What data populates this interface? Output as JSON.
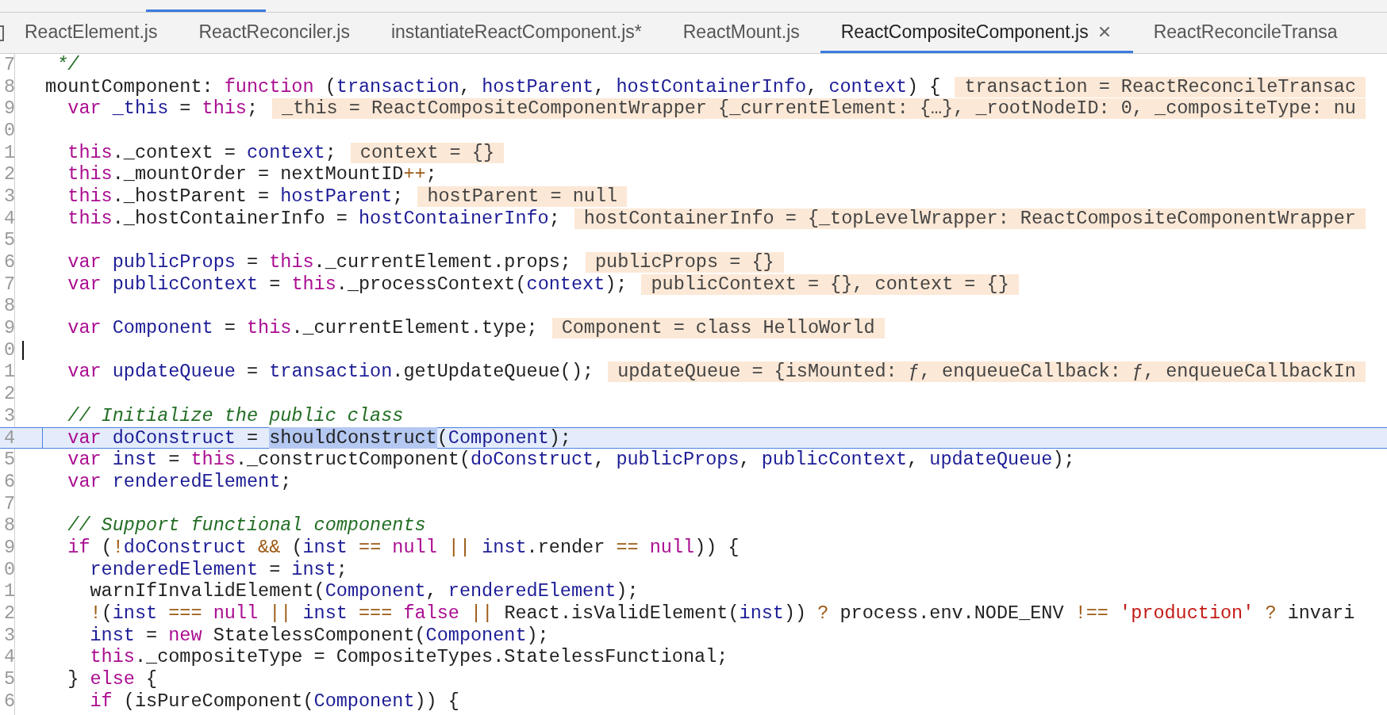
{
  "tabs": [
    {
      "label": "ReactElement.js",
      "selected": false
    },
    {
      "label": "ReactReconciler.js",
      "selected": false
    },
    {
      "label": "instantiateReactComponent.js*",
      "selected": false
    },
    {
      "label": "ReactMount.js",
      "selected": false
    },
    {
      "label": "ReactCompositeComponent.js",
      "selected": true
    },
    {
      "label": "ReactReconcileTransa",
      "selected": false
    }
  ],
  "editor": {
    "lines": [
      {
        "number": "7",
        "current": false,
        "has_cursor": false,
        "tokens": [
          {
            "kind": "comment",
            "text": "  */"
          }
        ]
      },
      {
        "number": "8",
        "current": false,
        "has_cursor": false,
        "tokens": [
          {
            "kind": "plain",
            "text": " mountComponent: "
          },
          {
            "kind": "kw",
            "text": "function"
          },
          {
            "kind": "plain",
            "text": " ("
          },
          {
            "kind": "def",
            "text": "transaction"
          },
          {
            "kind": "plain",
            "text": ", "
          },
          {
            "kind": "def",
            "text": "hostParent"
          },
          {
            "kind": "plain",
            "text": ", "
          },
          {
            "kind": "def",
            "text": "hostContainerInfo"
          },
          {
            "kind": "plain",
            "text": ", "
          },
          {
            "kind": "def",
            "text": "context"
          },
          {
            "kind": "plain",
            "text": ") {"
          }
        ],
        "inline_value": "transaction = ReactReconcileTransac"
      },
      {
        "number": "9",
        "current": false,
        "has_cursor": false,
        "tokens": [
          {
            "kind": "kw",
            "text": "   var "
          },
          {
            "kind": "def",
            "text": "_this"
          },
          {
            "kind": "plain",
            "text": " = "
          },
          {
            "kind": "kw",
            "text": "this"
          },
          {
            "kind": "plain",
            "text": ";"
          }
        ],
        "inline_value": "_this = ReactCompositeComponentWrapper {_currentElement: {…}, _rootNodeID: 0, _compositeType: nu"
      },
      {
        "number": "0",
        "current": false,
        "has_cursor": false
      },
      {
        "number": "1",
        "current": false,
        "has_cursor": false,
        "tokens": [
          {
            "kind": "kw",
            "text": "   this"
          },
          {
            "kind": "plain",
            "text": "._context = "
          },
          {
            "kind": "def",
            "text": "context"
          },
          {
            "kind": "plain",
            "text": ";"
          }
        ],
        "inline_value": "context = {}"
      },
      {
        "number": "2",
        "current": false,
        "has_cursor": false,
        "tokens": [
          {
            "kind": "kw",
            "text": "   this"
          },
          {
            "kind": "plain",
            "text": "._mountOrder = nextMountID"
          },
          {
            "kind": "op",
            "text": "++"
          },
          {
            "kind": "plain",
            "text": ";"
          }
        ]
      },
      {
        "number": "3",
        "current": false,
        "has_cursor": false,
        "tokens": [
          {
            "kind": "kw",
            "text": "   this"
          },
          {
            "kind": "plain",
            "text": "._hostParent = "
          },
          {
            "kind": "def",
            "text": "hostParent"
          },
          {
            "kind": "plain",
            "text": ";"
          }
        ],
        "inline_value": "hostParent = null"
      },
      {
        "number": "4",
        "current": false,
        "has_cursor": false,
        "tokens": [
          {
            "kind": "kw",
            "text": "   this"
          },
          {
            "kind": "plain",
            "text": "._hostContainerInfo = "
          },
          {
            "kind": "def",
            "text": "hostContainerInfo"
          },
          {
            "kind": "plain",
            "text": ";"
          }
        ],
        "inline_value": "hostContainerInfo = {_topLevelWrapper: ReactCompositeComponentWrapper"
      },
      {
        "number": "5",
        "current": false,
        "has_cursor": false
      },
      {
        "number": "6",
        "current": false,
        "has_cursor": false,
        "tokens": [
          {
            "kind": "kw",
            "text": "   var "
          },
          {
            "kind": "def",
            "text": "publicProps"
          },
          {
            "kind": "plain",
            "text": " = "
          },
          {
            "kind": "kw",
            "text": "this"
          },
          {
            "kind": "plain",
            "text": "._currentElement.props;"
          }
        ],
        "inline_value": "publicProps = {}"
      },
      {
        "number": "7",
        "current": false,
        "has_cursor": false,
        "tokens": [
          {
            "kind": "kw",
            "text": "   var "
          },
          {
            "kind": "def",
            "text": "publicContext"
          },
          {
            "kind": "plain",
            "text": " = "
          },
          {
            "kind": "kw",
            "text": "this"
          },
          {
            "kind": "plain",
            "text": "._processContext("
          },
          {
            "kind": "def",
            "text": "context"
          },
          {
            "kind": "plain",
            "text": ");"
          }
        ],
        "inline_value": "publicContext = {}, context = {}"
      },
      {
        "number": "8",
        "current": false,
        "has_cursor": false
      },
      {
        "number": "9",
        "current": false,
        "has_cursor": false,
        "tokens": [
          {
            "kind": "kw",
            "text": "   var "
          },
          {
            "kind": "def",
            "text": "Component"
          },
          {
            "kind": "plain",
            "text": " = "
          },
          {
            "kind": "kw",
            "text": "this"
          },
          {
            "kind": "plain",
            "text": "._currentElement.type;"
          }
        ],
        "inline_value": "Component = class HelloWorld"
      },
      {
        "number": "0",
        "current": false,
        "has_cursor": true
      },
      {
        "number": "1",
        "current": false,
        "has_cursor": false,
        "tokens": [
          {
            "kind": "kw",
            "text": "   var "
          },
          {
            "kind": "def",
            "text": "updateQueue"
          },
          {
            "kind": "plain",
            "text": " = "
          },
          {
            "kind": "def",
            "text": "transaction"
          },
          {
            "kind": "plain",
            "text": ".getUpdateQueue();"
          }
        ],
        "inline_value": "updateQueue = {isMounted: ƒ, enqueueCallback: ƒ, enqueueCallbackIn"
      },
      {
        "number": "2",
        "current": false,
        "has_cursor": false
      },
      {
        "number": "3",
        "current": false,
        "has_cursor": false,
        "tokens": [
          {
            "kind": "comment",
            "text": "   // Initialize the public class"
          }
        ]
      },
      {
        "number": "4",
        "current": true,
        "has_cursor": false,
        "tokens": [
          {
            "kind": "kw",
            "text": "   var ",
            "selected": false
          },
          {
            "kind": "def",
            "text": "doConstruct",
            "selected": false
          },
          {
            "kind": "plain",
            "text": " = ",
            "selected": false
          },
          {
            "kind": "plain",
            "text": "shouldConstruct",
            "selected": true
          },
          {
            "kind": "plain",
            "text": "(",
            "selected": false
          },
          {
            "kind": "def",
            "text": "Component",
            "selected": false
          },
          {
            "kind": "plain",
            "text": ");",
            "selected": false
          }
        ]
      },
      {
        "number": "5",
        "current": false,
        "has_cursor": false,
        "tokens": [
          {
            "kind": "kw",
            "text": "   var "
          },
          {
            "kind": "def",
            "text": "inst"
          },
          {
            "kind": "plain",
            "text": " = "
          },
          {
            "kind": "kw",
            "text": "this"
          },
          {
            "kind": "plain",
            "text": "._constructComponent("
          },
          {
            "kind": "def",
            "text": "doConstruct"
          },
          {
            "kind": "plain",
            "text": ", "
          },
          {
            "kind": "def",
            "text": "publicProps"
          },
          {
            "kind": "plain",
            "text": ", "
          },
          {
            "kind": "def",
            "text": "publicContext"
          },
          {
            "kind": "plain",
            "text": ", "
          },
          {
            "kind": "def",
            "text": "updateQueue"
          },
          {
            "kind": "plain",
            "text": ");"
          }
        ]
      },
      {
        "number": "6",
        "current": false,
        "has_cursor": false,
        "tokens": [
          {
            "kind": "kw",
            "text": "   var "
          },
          {
            "kind": "def",
            "text": "renderedElement"
          },
          {
            "kind": "plain",
            "text": ";"
          }
        ]
      },
      {
        "number": "7",
        "current": false,
        "has_cursor": false
      },
      {
        "number": "8",
        "current": false,
        "has_cursor": false,
        "tokens": [
          {
            "kind": "comment",
            "text": "   // Support functional components"
          }
        ]
      },
      {
        "number": "9",
        "current": false,
        "has_cursor": false,
        "tokens": [
          {
            "kind": "kw",
            "text": "   if"
          },
          {
            "kind": "plain",
            "text": " ("
          },
          {
            "kind": "op",
            "text": "!"
          },
          {
            "kind": "def",
            "text": "doConstruct "
          },
          {
            "kind": "op",
            "text": "&&"
          },
          {
            "kind": "plain",
            "text": " ("
          },
          {
            "kind": "def",
            "text": "inst "
          },
          {
            "kind": "op",
            "text": "== "
          },
          {
            "kind": "kw",
            "text": "null "
          },
          {
            "kind": "op",
            "text": "|| "
          },
          {
            "kind": "def",
            "text": "inst"
          },
          {
            "kind": "plain",
            "text": ".render "
          },
          {
            "kind": "op",
            "text": "== "
          },
          {
            "kind": "kw",
            "text": "null"
          },
          {
            "kind": "plain",
            "text": ")) {"
          }
        ]
      },
      {
        "number": "0",
        "current": false,
        "has_cursor": false,
        "tokens": [
          {
            "kind": "def",
            "text": "     renderedElement"
          },
          {
            "kind": "plain",
            "text": " = "
          },
          {
            "kind": "def",
            "text": "inst"
          },
          {
            "kind": "plain",
            "text": ";"
          }
        ]
      },
      {
        "number": "1",
        "current": false,
        "has_cursor": false,
        "tokens": [
          {
            "kind": "plain",
            "text": "     warnIfInvalidElement("
          },
          {
            "kind": "def",
            "text": "Component"
          },
          {
            "kind": "plain",
            "text": ", "
          },
          {
            "kind": "def",
            "text": "renderedElement"
          },
          {
            "kind": "plain",
            "text": ");"
          }
        ]
      },
      {
        "number": "2",
        "current": false,
        "has_cursor": false,
        "tokens": [
          {
            "kind": "op",
            "text": "     !"
          },
          {
            "kind": "plain",
            "text": "("
          },
          {
            "kind": "def",
            "text": "inst "
          },
          {
            "kind": "op",
            "text": "=== "
          },
          {
            "kind": "kw",
            "text": "null "
          },
          {
            "kind": "op",
            "text": "|| "
          },
          {
            "kind": "def",
            "text": "inst "
          },
          {
            "kind": "op",
            "text": "=== "
          },
          {
            "kind": "kw",
            "text": "false "
          },
          {
            "kind": "op",
            "text": "||"
          },
          {
            "kind": "plain",
            "text": " React.isValidElement("
          },
          {
            "kind": "def",
            "text": "inst"
          },
          {
            "kind": "plain",
            "text": ")) "
          },
          {
            "kind": "op",
            "text": "?"
          },
          {
            "kind": "plain",
            "text": " process.env.NODE_ENV "
          },
          {
            "kind": "op",
            "text": "!== "
          },
          {
            "kind": "str",
            "text": "'production' "
          },
          {
            "kind": "op",
            "text": "?"
          },
          {
            "kind": "plain",
            "text": " invari"
          }
        ]
      },
      {
        "number": "3",
        "current": false,
        "has_cursor": false,
        "tokens": [
          {
            "kind": "def",
            "text": "     inst"
          },
          {
            "kind": "plain",
            "text": " = "
          },
          {
            "kind": "kw",
            "text": "new"
          },
          {
            "kind": "plain",
            "text": " StatelessComponent("
          },
          {
            "kind": "def",
            "text": "Component"
          },
          {
            "kind": "plain",
            "text": ");"
          }
        ]
      },
      {
        "number": "4",
        "current": false,
        "has_cursor": false,
        "tokens": [
          {
            "kind": "kw",
            "text": "     this"
          },
          {
            "kind": "plain",
            "text": "._compositeType = CompositeTypes.StatelessFunctional;"
          }
        ]
      },
      {
        "number": "5",
        "current": false,
        "has_cursor": false,
        "tokens": [
          {
            "kind": "plain",
            "text": "   } "
          },
          {
            "kind": "kw",
            "text": "else"
          },
          {
            "kind": "plain",
            "text": " {"
          }
        ]
      },
      {
        "number": "6",
        "current": false,
        "has_cursor": false,
        "tokens": [
          {
            "kind": "kw",
            "text": "     if"
          },
          {
            "kind": "plain",
            "text": " (isPureComponent("
          },
          {
            "kind": "def",
            "text": "Component"
          },
          {
            "kind": "plain",
            "text": ")) {"
          }
        ]
      }
    ]
  }
}
